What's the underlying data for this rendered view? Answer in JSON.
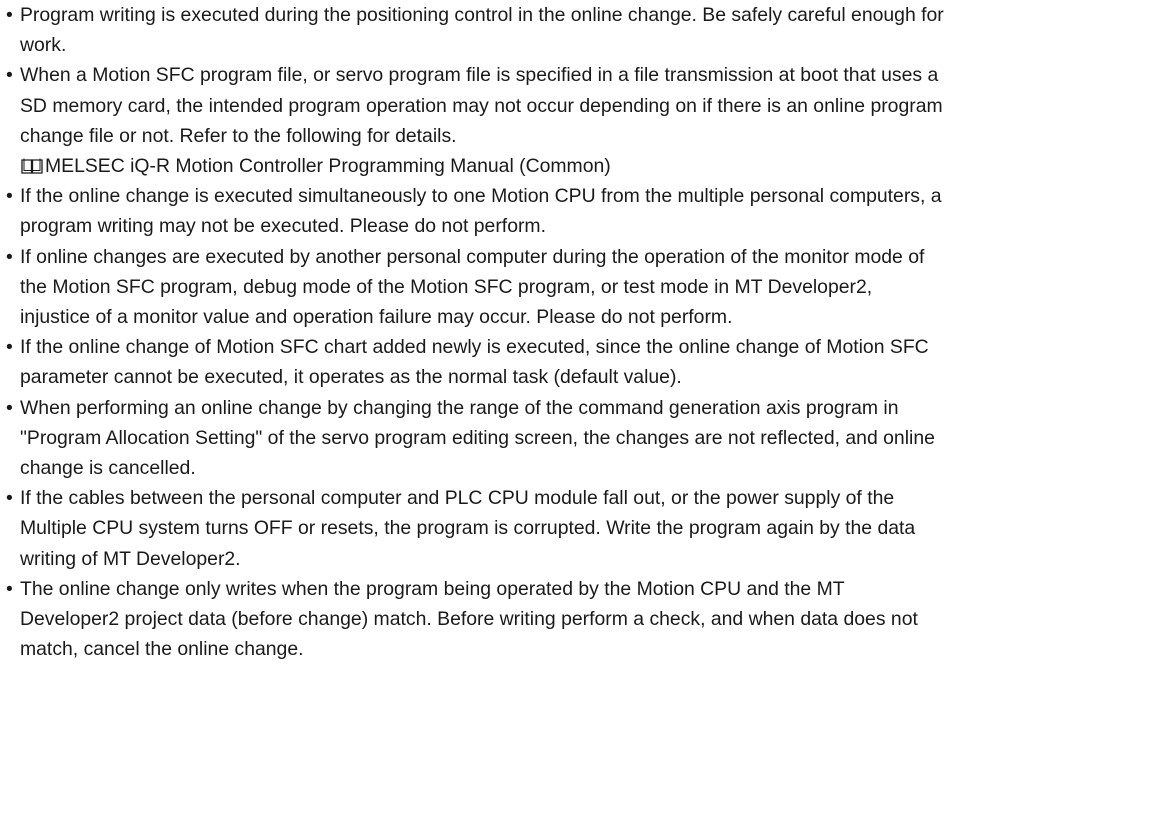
{
  "bullet_glyph": "•",
  "notes": [
    {
      "lines": [
        "Program writing is executed during the positioning control in the online change. Be safely careful enough for",
        "work."
      ]
    },
    {
      "lines": [
        "When a Motion SFC program file, or servo program file is specified in a file transmission at boot that uses a",
        "SD memory card, the intended program operation may not occur depending on if there is an online program",
        "change file or not. Refer to the following for details."
      ],
      "reference": {
        "icon": "manual-book-icon",
        "text": "MELSEC iQ-R Motion Controller Programming Manual (Common)"
      }
    },
    {
      "lines": [
        "If the online change is executed simultaneously to one Motion CPU from the multiple personal computers, a",
        "program writing may not be executed. Please do not perform."
      ]
    },
    {
      "lines": [
        "If online changes are executed by another personal computer during the operation of the monitor mode of",
        "the Motion SFC program, debug mode of the Motion SFC program, or test mode in MT Developer2,",
        "injustice of a monitor value and operation failure may occur. Please do not perform."
      ]
    },
    {
      "lines": [
        "If the online change of Motion SFC chart added newly is executed, since the online change of Motion SFC",
        "parameter cannot be executed, it operates as the normal task (default value)."
      ]
    },
    {
      "lines": [
        "When performing an online change by changing the range of the command generation axis program in",
        "\"Program Allocation Setting\" of the servo program editing screen, the changes are not reflected, and online",
        "change is cancelled."
      ]
    },
    {
      "lines": [
        "If the cables between the personal computer and PLC CPU module fall out, or the power supply of the",
        "Multiple CPU system turns OFF or resets, the program is corrupted. Write the program again by the data",
        "writing of MT Developer2."
      ]
    },
    {
      "lines": [
        "The online change only writes when the program being operated by the Motion CPU and the MT",
        "Developer2 project data (before change) match. Before writing perform a check, and when data does not",
        "match, cancel the online change."
      ]
    }
  ]
}
